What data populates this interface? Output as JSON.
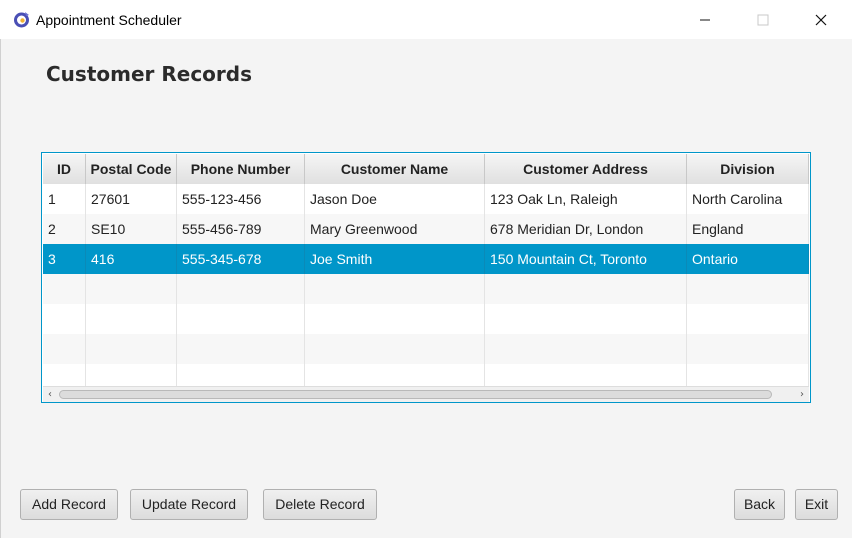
{
  "window": {
    "title": "Appointment Scheduler",
    "controls": [
      "minimize",
      "maximize",
      "close"
    ]
  },
  "page": {
    "title": "Customer Records"
  },
  "table": {
    "columns": [
      "ID",
      "Postal Code",
      "Phone Number",
      "Customer Name",
      "Customer Address",
      "Division"
    ],
    "rows": [
      [
        "1",
        "27601",
        "555-123-456",
        "Jason Doe",
        "123 Oak Ln, Raleigh",
        "North Carolina"
      ],
      [
        "2",
        "SE10",
        "555-456-789",
        "Mary Greenwood",
        "678 Meridian Dr, London",
        "England"
      ],
      [
        "3",
        "416",
        "555-345-678",
        "Joe Smith",
        "150 Mountain Ct, Toronto",
        "Ontario"
      ]
    ],
    "selected_row": 3,
    "accent_color": "#0096c9"
  },
  "buttons": {
    "add": "Add Record",
    "update": "Update Record",
    "delete": "Delete Record",
    "back": "Back",
    "exit": "Exit"
  },
  "icons": {
    "app": "app-logo-icon",
    "minimize": "minimize-icon",
    "maximize": "maximize-icon",
    "close": "close-icon",
    "scroll_left": "chevron-left-icon",
    "scroll_right": "chevron-right-icon"
  }
}
